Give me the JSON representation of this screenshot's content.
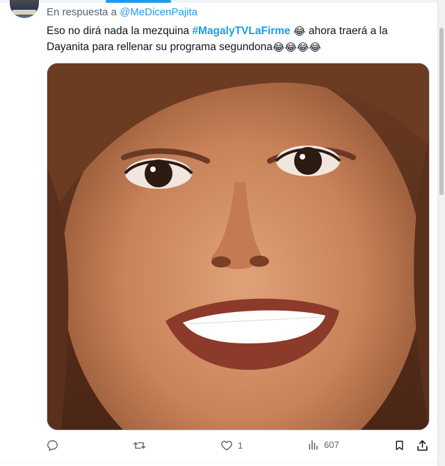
{
  "reply": {
    "prefix": "En respuesta a",
    "mention": "@MeDicenPajita"
  },
  "tweet": {
    "text_1": "Eso no dirá nada la mezquina",
    "hashtag": "#MagalyTVLaFirme",
    "emoji_single": "😂",
    "text_2": "ahora traerá a la Dayanita para rellenar su programa segundona",
    "emoji_quad": "😂😂😂😂"
  },
  "actions": {
    "reply_count": "",
    "retweet_count": "",
    "like_count": "1",
    "views_count": "607"
  },
  "colors": {
    "accent": "#1d9bf0",
    "muted": "#536471",
    "text": "#0f1419"
  },
  "icons": [
    "reply-icon",
    "retweet-icon",
    "like-icon",
    "views-icon",
    "bookmark-icon",
    "share-icon"
  ]
}
